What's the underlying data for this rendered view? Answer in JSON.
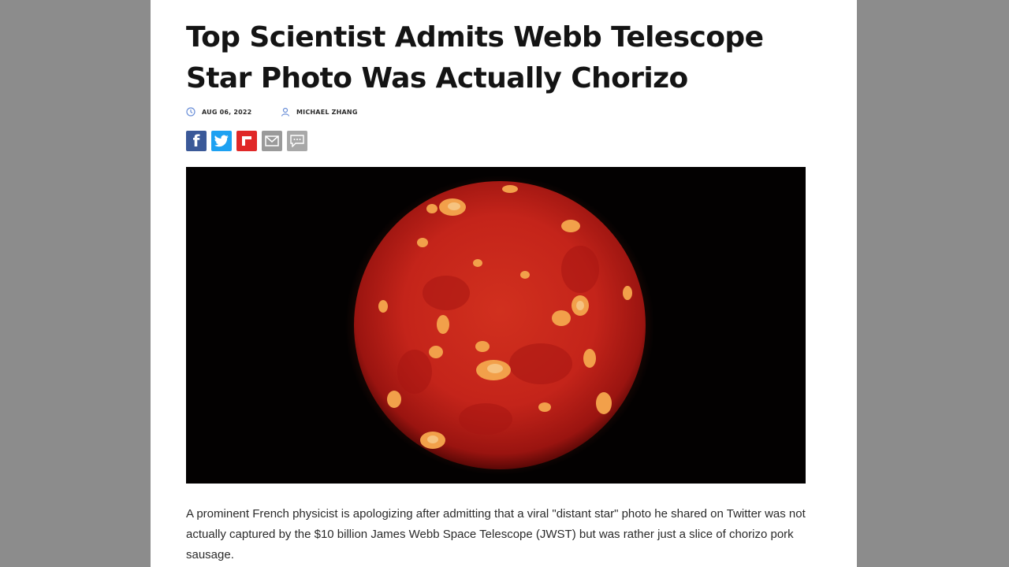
{
  "article": {
    "title": "Top Scientist Admits Webb Telescope Star Photo Was Actually Chorizo",
    "date": "AUG 06, 2022",
    "author": "MICHAEL ZHANG",
    "share_icons": [
      "facebook-icon",
      "twitter-icon",
      "flipboard-icon",
      "email-icon",
      "comment-icon"
    ],
    "image_alt": "chorizo slice photo",
    "paragraph": "A prominent French physicist is apologizing after admitting that a viral \"distant star\" photo he shared on Twitter was not actually captured by the $10 billion James Webb Space Telescope (JWST) but was rather just a slice of chorizo pork sausage."
  },
  "colors": {
    "backdrop": "#8c8c8c",
    "facebook": "#3b5998",
    "twitter": "#1da1f2",
    "flipboard": "#e02828",
    "meta_icon": "#6a8fd8"
  }
}
